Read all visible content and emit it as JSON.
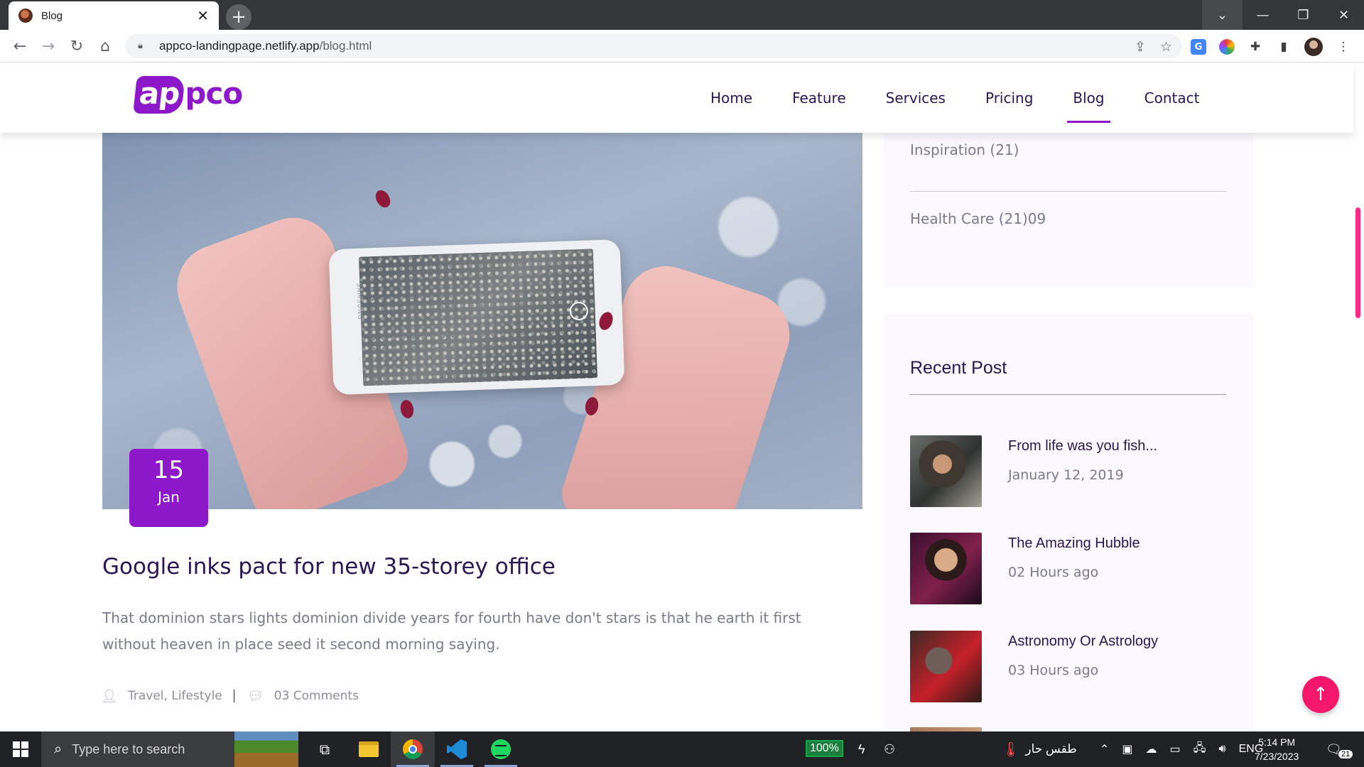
{
  "browser": {
    "tab_title": "Blog",
    "tab_close": "✕",
    "new_tab": "+",
    "url_domain": "appco-landingpage.netlify.app",
    "url_path": "/blog.html"
  },
  "site": {
    "logo_left": "ap",
    "logo_right": "pco",
    "nav": [
      {
        "label": "Home"
      },
      {
        "label": "Feature"
      },
      {
        "label": "Services"
      },
      {
        "label": "Pricing"
      },
      {
        "label": "Blog",
        "active": true
      },
      {
        "label": "Contact"
      }
    ]
  },
  "post": {
    "date_day": "15",
    "date_month": "Jan",
    "phone_brand": "SAMSUNG",
    "title": "Google inks pact for new 35-storey office",
    "excerpt": "That dominion stars lights dominion divide years for fourth have don't stars is that he earth it first without heaven in place seed it second morning saying.",
    "categories": "Travel, Lifestyle",
    "comments": "03 Comments"
  },
  "sidebar": {
    "categories": [
      {
        "label": "Inspiration (21)"
      },
      {
        "label": "Health Care (21)09"
      }
    ],
    "recent_title": "Recent Post",
    "recent_posts": [
      {
        "title": "From life was you fish...",
        "date": "January 12, 2019"
      },
      {
        "title": "The Amazing Hubble",
        "date": "02 Hours ago"
      },
      {
        "title": "Astronomy Or Astrology",
        "date": "03 Hours ago"
      }
    ]
  },
  "taskbar": {
    "search_placeholder": "Type here to search",
    "battery": "100%",
    "weather": "طقس حار",
    "language": "ENG",
    "time": "5:14 PM",
    "date": "7/23/2023",
    "notifications": "21"
  },
  "colors": {
    "brand_purple": "#8d18c9",
    "heading_navy": "#2b1553",
    "accent_pink": "#f5176b"
  }
}
